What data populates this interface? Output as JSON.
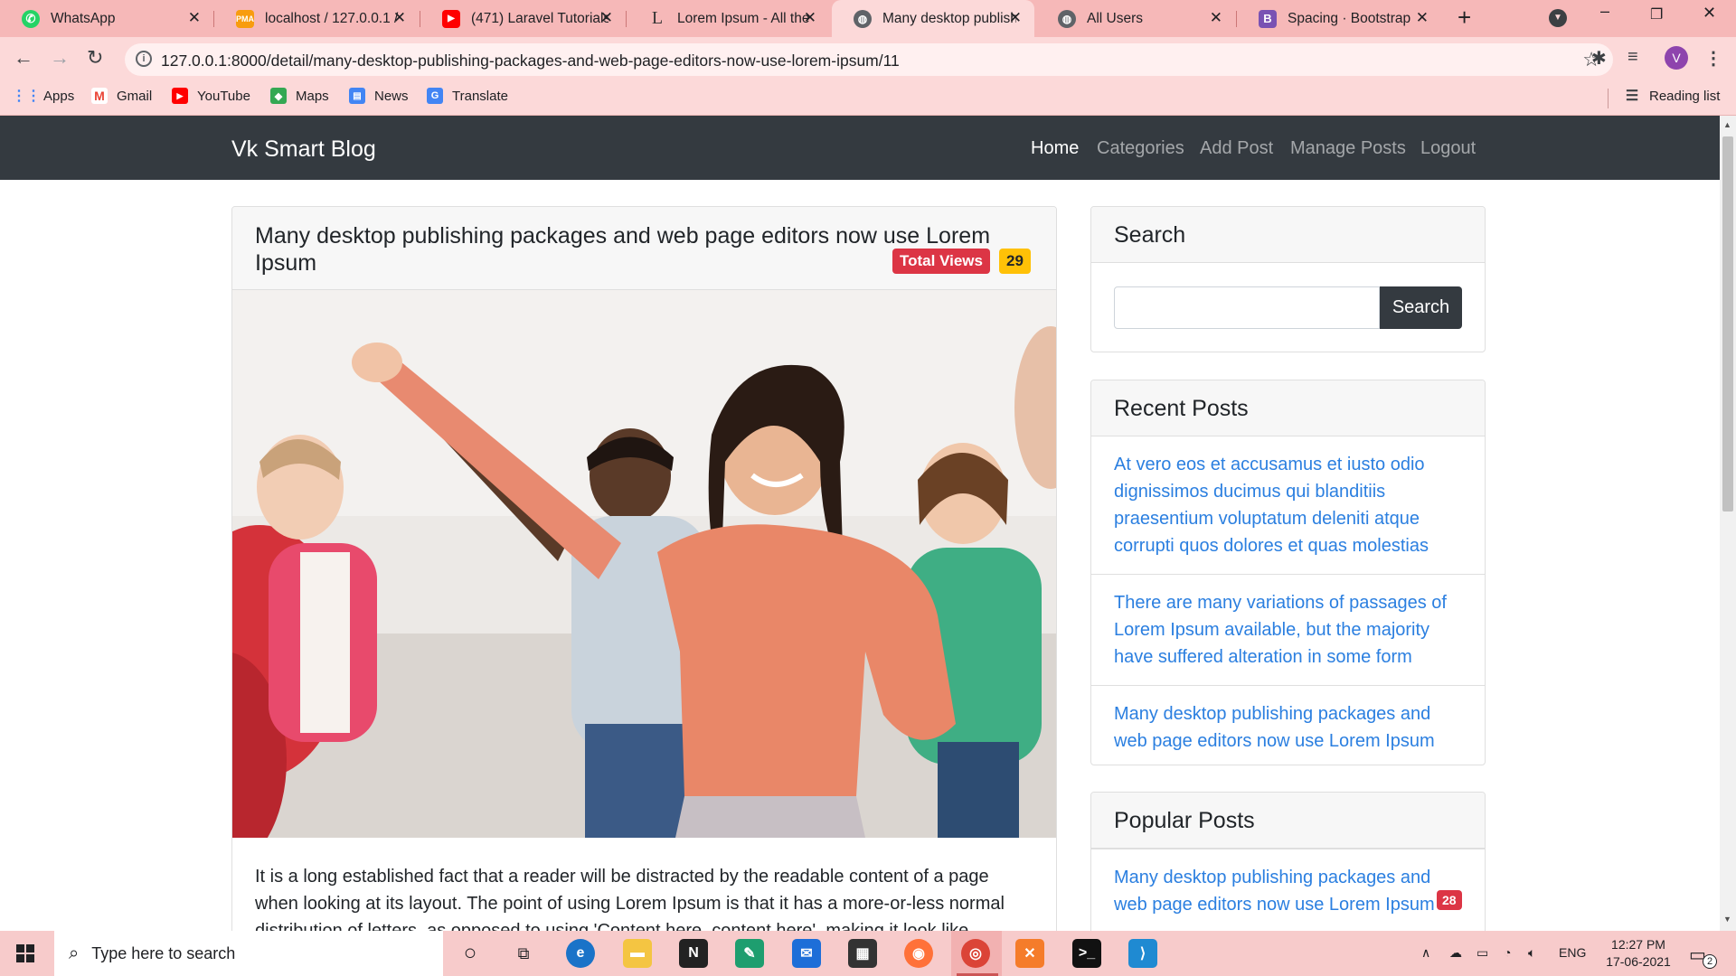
{
  "browser": {
    "tabs": [
      {
        "title": "WhatsApp",
        "icon": "whatsapp-icon",
        "color": "#25d366"
      },
      {
        "title": "localhost / 127.0.0.1 /",
        "icon": "phpmyadmin-icon",
        "color": "#f89c0e"
      },
      {
        "title": "(471) Laravel Tutorials",
        "icon": "youtube-icon",
        "color": "#ff0000"
      },
      {
        "title": "Lorem Ipsum - All the",
        "icon": "lipsum-icon",
        "color": "#333333"
      },
      {
        "title": "Many desktop publish",
        "icon": "globe-icon",
        "color": "#5f6368"
      },
      {
        "title": "All Users",
        "icon": "globe-icon",
        "color": "#5f6368"
      },
      {
        "title": "Spacing · Bootstrap",
        "icon": "bootstrap-icon",
        "color": "#7952b3"
      }
    ],
    "url": "127.0.0.1:8000/detail/many-desktop-publishing-packages-and-web-page-editors-now-use-lorem-ipsum/11",
    "avatar": "V",
    "bookmarks": [
      "Apps",
      "Gmail",
      "YouTube",
      "Maps",
      "News",
      "Translate"
    ],
    "reading_list": "Reading list"
  },
  "site": {
    "brand": "Vk Smart Blog",
    "nav": [
      "Home",
      "Categories",
      "Add Post",
      "Manage Posts",
      "Logout"
    ]
  },
  "post": {
    "title": "Many desktop publishing packages and web page editors now use Lorem Ipsum",
    "views_label": "Total Views",
    "views": "29",
    "body": "It is a long established fact that a reader will be distracted by the readable content of a page when looking at its layout. The point of using Lorem Ipsum is that it has a more-or-less normal distribution of letters, as opposed to using 'Content here, content here', making it look like"
  },
  "sidebar": {
    "search_title": "Search",
    "search_button": "Search",
    "search_value": "",
    "recent_title": "Recent Posts",
    "recent": [
      "At vero eos et accusamus et iusto odio dignissimos ducimus qui blanditiis praesentium voluptatum deleniti atque corrupti quos dolores et quas molestias",
      "There are many variations of passages of Lorem Ipsum available, but the majority have suffered alteration in some form",
      "Many desktop publishing packages and web page editors now use Lorem Ipsum"
    ],
    "popular_title": "Popular Posts",
    "popular": [
      {
        "title": "Many desktop publishing packages and web page editors now use Lorem Ipsum",
        "count": "28"
      }
    ]
  },
  "taskbar": {
    "search_placeholder": "Type here to search",
    "lang": "ENG",
    "time": "12:27 PM",
    "date": "17-06-2021",
    "notifications": "2"
  }
}
